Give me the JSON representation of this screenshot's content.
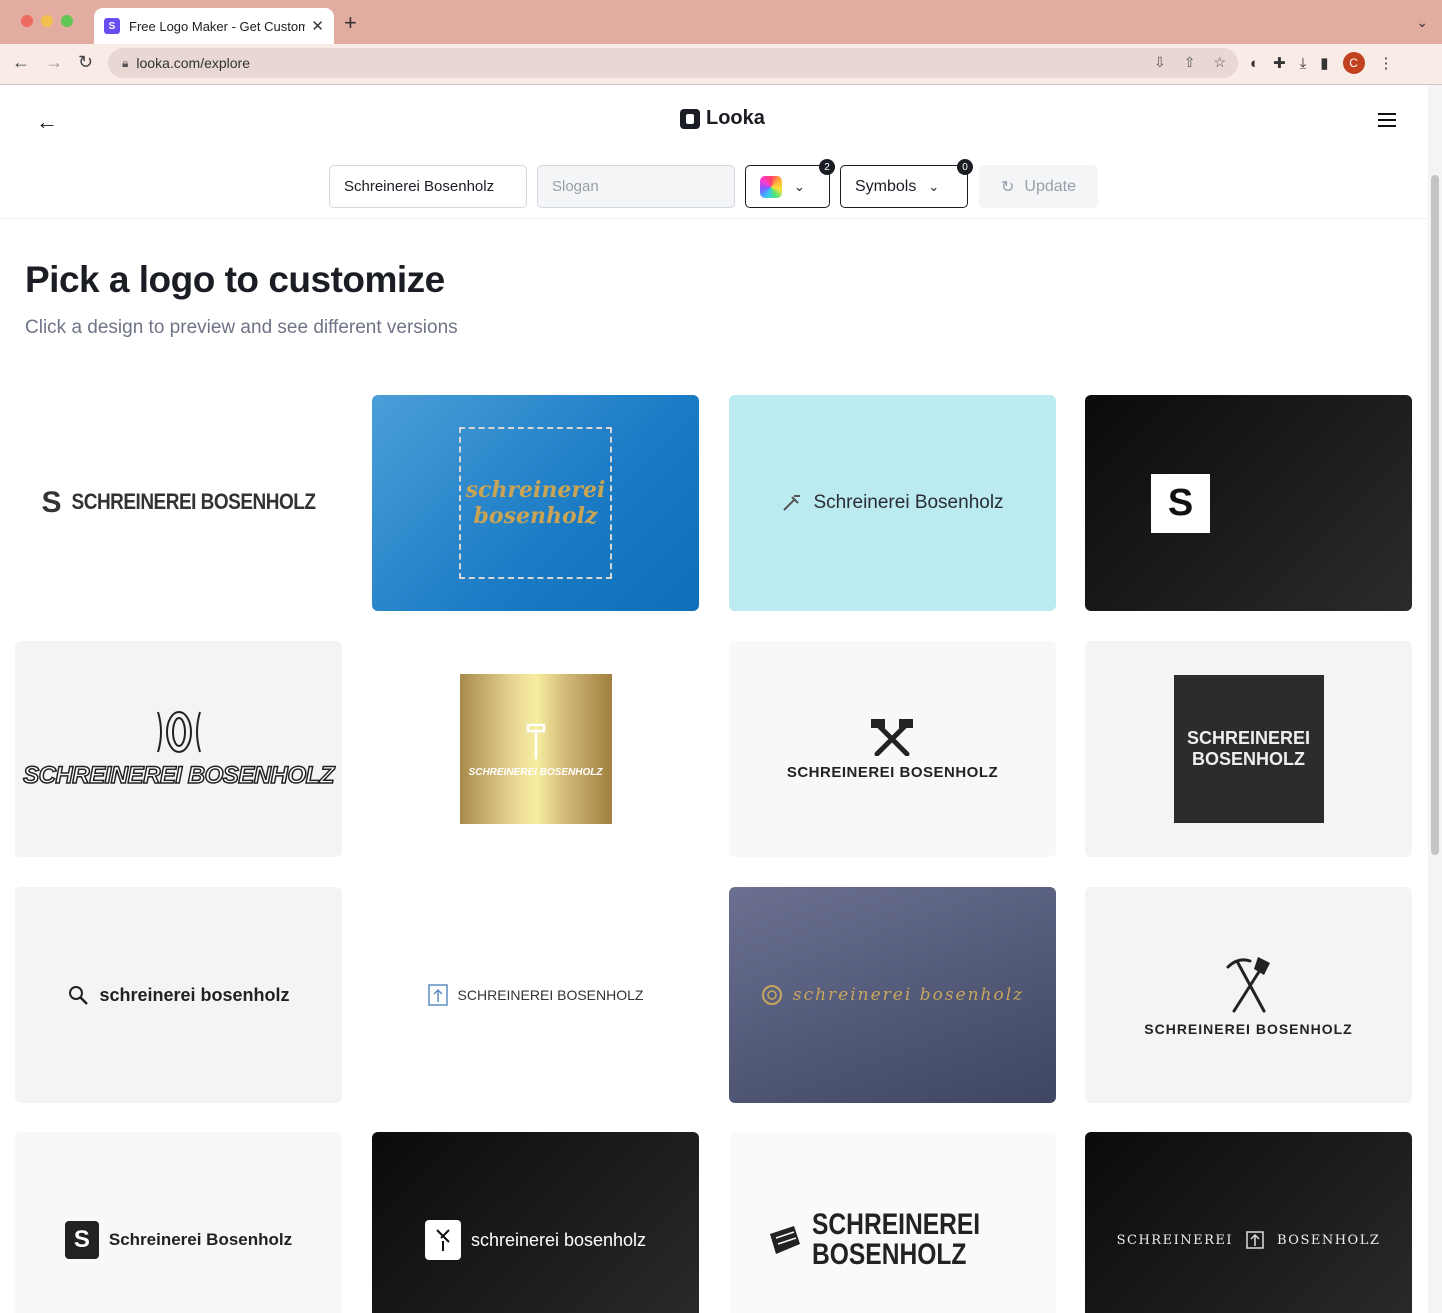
{
  "browser": {
    "tab_title": "Free Logo Maker - Get Custom",
    "tab_favicon": "S",
    "url": "looka.com/explore",
    "avatar_initial": "C"
  },
  "header": {
    "brand": "Looka"
  },
  "filters": {
    "company_name": "Schreinerei Bosenholz",
    "slogan_placeholder": "Slogan",
    "colors_badge": "2",
    "symbols_label": "Symbols",
    "symbols_badge": "0",
    "update_label": "Update"
  },
  "main": {
    "title": "Pick a logo to customize",
    "subtitle": "Click a design to preview and see different versions"
  },
  "logos": [
    {
      "text": "SCHREINEREI BOSENHOLZ",
      "mark": "S",
      "style": "stencil"
    },
    {
      "text_line1": "schreinerei",
      "text_line2": "bosenholz",
      "style": "gold-script-frame"
    },
    {
      "text": "Schreinerei Bosenholz",
      "mark": "hammer-icon",
      "style": "plain"
    },
    {
      "text": "S",
      "style": "white-square"
    },
    {
      "text": "SCHREINEREI BOSENHOLZ",
      "mark": "wood-grain-icon",
      "style": "wood"
    },
    {
      "text": "SCHREINEREI BOSENHOLZ",
      "mark": "hammer-icon",
      "style": "gold-plate"
    },
    {
      "text": "SCHREINEREI BOSENHOLZ",
      "mark": "crossed-hammers-icon",
      "style": "bold"
    },
    {
      "text_line1": "SCHREINEREI",
      "text_line2": "BOSENHOLZ",
      "style": "stamp"
    },
    {
      "text": "schreinerei bosenholz",
      "mark": "magnifier-icon",
      "style": "bold-lower"
    },
    {
      "text": "SCHREINEREI BOSENHOLZ",
      "mark": "tree-icon",
      "style": "thin"
    },
    {
      "text": "schreinerei bosenholz",
      "mark": "ring-icon",
      "style": "gold-script"
    },
    {
      "text": "SCHREINEREI BOSENHOLZ",
      "mark": "pickaxe-shovel-icon",
      "style": "bold"
    },
    {
      "text": "Schreinerei Bosenholz",
      "mark": "S",
      "style": "rounded-badge"
    },
    {
      "text": "schreinerei bosenholz",
      "mark": "shovel-icon",
      "style": "white-badge"
    },
    {
      "text_line1": "SCHREINEREI",
      "text_line2": "BOSENHOLZ",
      "mark": "plank-icon",
      "style": "condensed"
    },
    {
      "text_left": "SCHREINEREI",
      "text_right": "BOSENHOLZ",
      "mark": "tree-icon",
      "style": "serif-caps"
    }
  ]
}
